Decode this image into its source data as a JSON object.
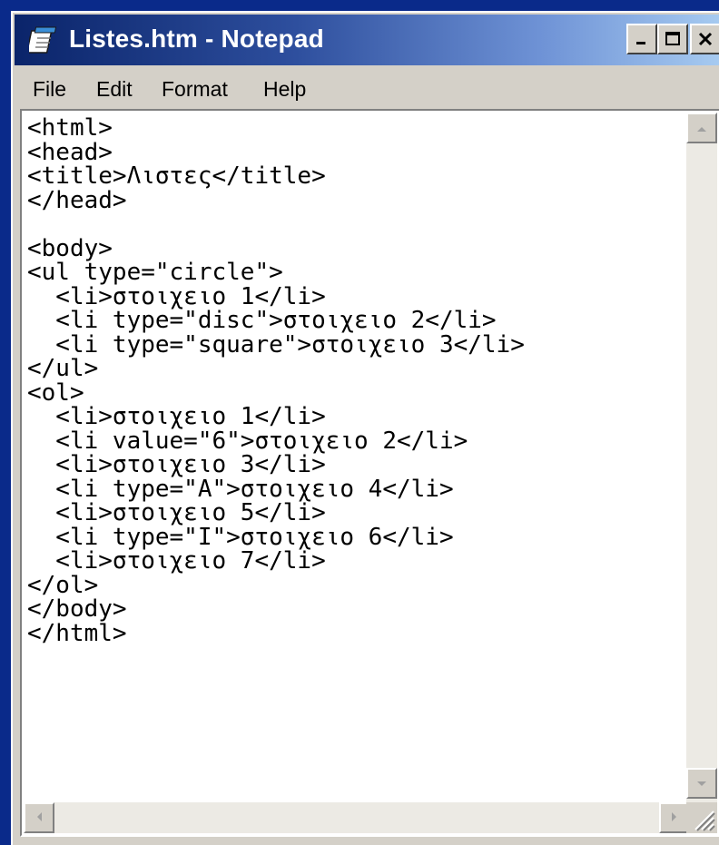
{
  "window": {
    "title": "Listes.htm - Notepad",
    "icon": "notepad-icon"
  },
  "titlebar_buttons": [
    {
      "name": "minimize",
      "icon": "minimize-icon"
    },
    {
      "name": "maximize",
      "icon": "maximize-icon"
    },
    {
      "name": "close",
      "icon": "close-icon"
    }
  ],
  "menu": {
    "file": "File",
    "edit": "Edit",
    "format": "Format",
    "help": "Help"
  },
  "editor": {
    "lines": [
      "<html>",
      "<head>",
      "<title>Λιστες</title>",
      "</head>",
      "",
      "<body>",
      "<ul type=\"circle\">",
      "  <li>στοιχειο 1</li>",
      "  <li type=\"disc\">στοιχειο 2</li>",
      "  <li type=\"square\">στοιχειο 3</li>",
      "</ul>",
      "<ol>",
      "  <li>στοιχειο 1</li>",
      "  <li value=\"6\">στοιχειο 2</li>",
      "  <li>στοιχειο 3</li>",
      "  <li type=\"A\">στοιχειο 4</li>",
      "  <li>στοιχειο 5</li>",
      "  <li type=\"I\">στοιχειο 6</li>",
      "  <li>στοιχειο 7</li>",
      "</ol>",
      "</body>",
      "</html>"
    ]
  },
  "colors": {
    "titlebar_start": "#0a246a",
    "titlebar_end": "#a6caf0",
    "chrome": "#d4d0c8",
    "desktop": "#0a2a8a"
  }
}
